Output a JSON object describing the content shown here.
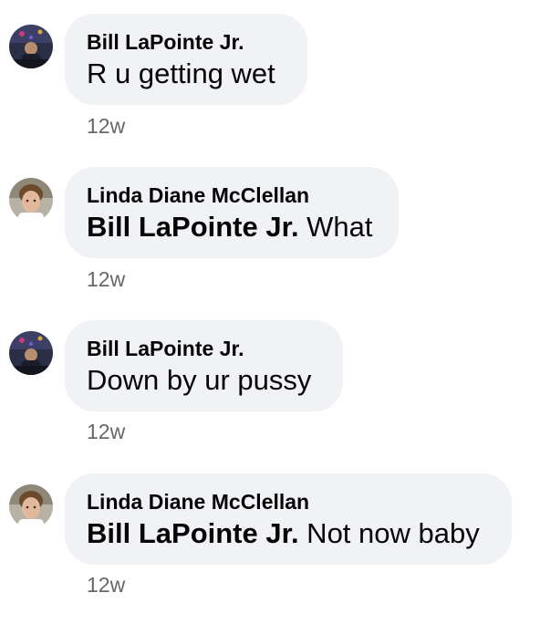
{
  "comments": [
    {
      "author": "Bill LaPointe Jr.",
      "mention": "",
      "text": "R u getting wet",
      "time": "12w",
      "avatar": "bill-avatar"
    },
    {
      "author": "Linda Diane McClellan",
      "mention": "Bill LaPointe Jr.",
      "text": " What",
      "time": "12w",
      "avatar": "linda-avatar"
    },
    {
      "author": "Bill LaPointe Jr.",
      "mention": "",
      "text": "Down by ur pussy",
      "time": "12w",
      "avatar": "bill-avatar"
    },
    {
      "author": "Linda Diane McClellan",
      "mention": "Bill LaPointe Jr.",
      "text": " Not now baby",
      "time": "12w",
      "avatar": "linda-avatar"
    }
  ],
  "colors": {
    "bubble_bg": "#f0f2f5",
    "text": "#050505",
    "timestamp": "#65676b"
  }
}
